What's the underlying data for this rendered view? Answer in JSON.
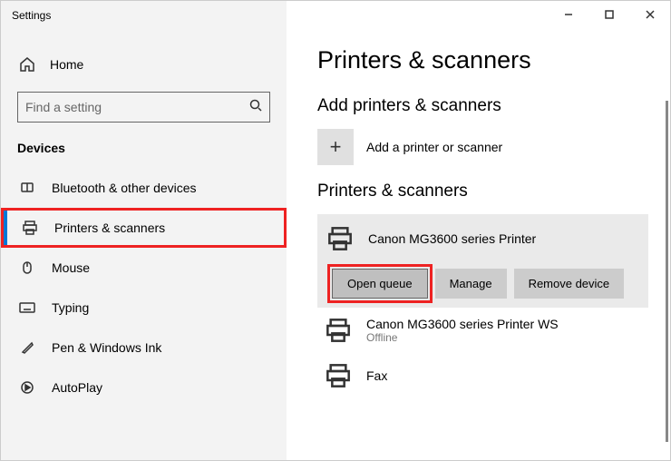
{
  "window": {
    "title": "Settings"
  },
  "sidebar": {
    "home": "Home",
    "search_placeholder": "Find a setting",
    "category": "Devices",
    "items": [
      {
        "label": "Bluetooth & other devices"
      },
      {
        "label": "Printers & scanners"
      },
      {
        "label": "Mouse"
      },
      {
        "label": "Typing"
      },
      {
        "label": "Pen & Windows Ink"
      },
      {
        "label": "AutoPlay"
      }
    ]
  },
  "main": {
    "title": "Printers & scanners",
    "add_section": "Add printers & scanners",
    "add_label": "Add a printer or scanner",
    "list_section": "Printers & scanners",
    "selected": {
      "name": "Canon MG3600 series Printer",
      "actions": {
        "open_queue": "Open queue",
        "manage": "Manage",
        "remove": "Remove device"
      }
    },
    "others": [
      {
        "name": "Canon MG3600 series Printer WS",
        "status": "Offline"
      },
      {
        "name": "Fax"
      }
    ]
  }
}
